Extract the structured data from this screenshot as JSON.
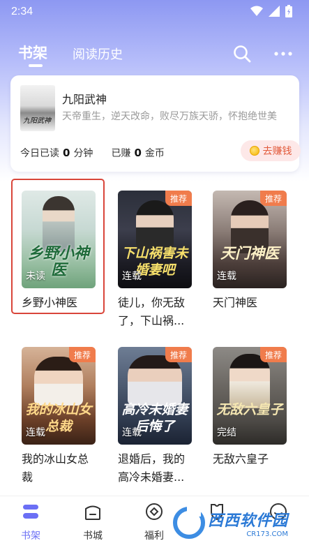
{
  "status": {
    "time": "2:34"
  },
  "nav": {
    "tab_shelf": "书架",
    "tab_history": "阅读历史"
  },
  "recent": {
    "cover_text": "九阳武神",
    "title": "九阳武神",
    "desc": "天帝重生，逆天改命，败尽万族天骄，怀抱绝世美",
    "read_prefix": "今日已读",
    "read_value": "0",
    "read_unit": "分钟",
    "earn_prefix": "已赚",
    "earn_value": "0",
    "earn_unit": "金币",
    "earn_button": "去赚钱"
  },
  "books": [
    {
      "title": "乡野小神医",
      "cover_text": "乡野小神医",
      "status": "未读",
      "badge": ""
    },
    {
      "title": "徒儿，你无敌了，下山祸...",
      "cover_text": "下山祸害未婚妻吧",
      "status": "连载",
      "badge": "推荐"
    },
    {
      "title": "天门神医",
      "cover_text": "天门神医",
      "status": "连载",
      "badge": "推荐"
    },
    {
      "title": "我的冰山女总裁",
      "cover_text": "我的冰山女总裁",
      "status": "连载",
      "badge": "推荐"
    },
    {
      "title": "退婚后，我的高冷未婚妻...",
      "cover_text": "高冷未婚妻后悔了",
      "status": "连载",
      "badge": "推荐"
    },
    {
      "title": "无敌六皇子",
      "cover_text": "无敌六皇子",
      "status": "完结",
      "badge": "推荐"
    }
  ],
  "tabbar": {
    "shelf": "书架",
    "store": "书城",
    "welfare": "福利",
    "item4": "",
    "item5": ""
  },
  "watermark": {
    "main": "西西软件园",
    "sub": "CR173.COM"
  },
  "colors": {
    "accent": "#6b6ff5",
    "badge": "#f07c4c",
    "earn": "#e25b3c",
    "selection": "#d9453a"
  }
}
